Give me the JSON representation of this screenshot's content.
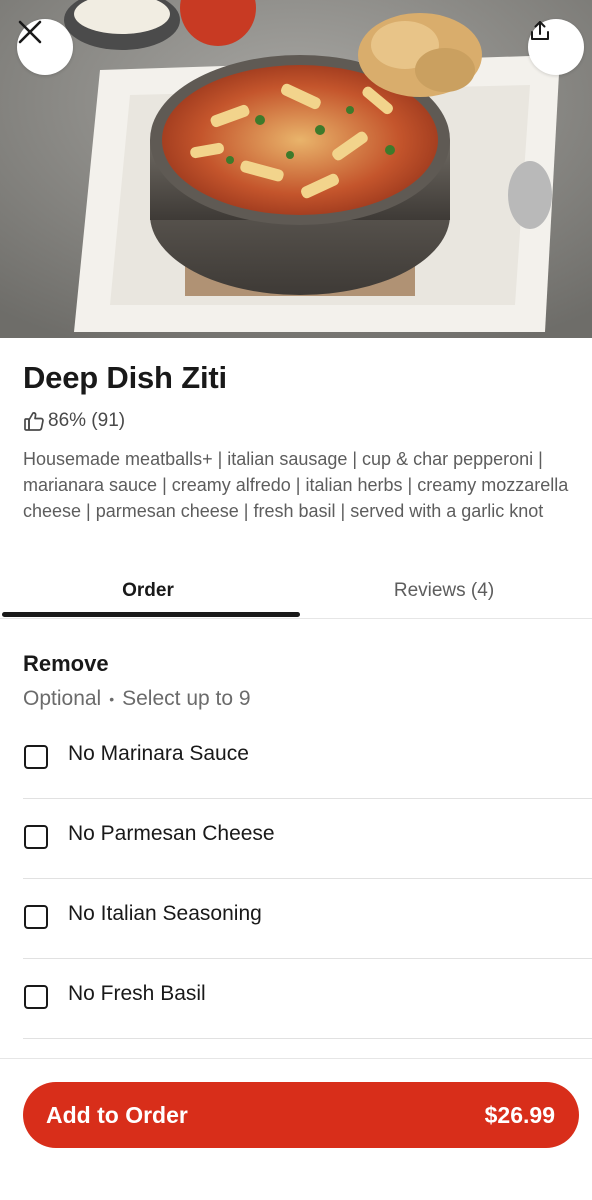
{
  "item": {
    "title": "Deep Dish Ziti",
    "rating": "86% (91)",
    "description": "Housemade meatballs+ | italian sausage | cup & char pepperoni | marianara sauce | creamy alfredo | italian herbs | creamy mozzarella cheese | parmesan cheese | fresh basil | served with a garlic knot"
  },
  "tabs": [
    {
      "label": "Order"
    },
    {
      "label": "Reviews (4)"
    }
  ],
  "remove_section": {
    "title": "Remove",
    "optional": "Optional",
    "limit": "Select up to 9",
    "options": [
      {
        "label": "No Marinara Sauce",
        "checked": false
      },
      {
        "label": "No Parmesan Cheese",
        "checked": false
      },
      {
        "label": "No Italian Seasoning",
        "checked": false
      },
      {
        "label": "No Fresh Basil",
        "checked": false
      }
    ]
  },
  "footer": {
    "add_label": "Add to Order",
    "price": "$26.99"
  },
  "colors": {
    "accent": "#d82e1a",
    "text": "#191919",
    "muted": "#5d5d5d"
  },
  "icons": {
    "close": "close-icon",
    "share": "share-icon",
    "rating": "thumbs-up-icon"
  }
}
